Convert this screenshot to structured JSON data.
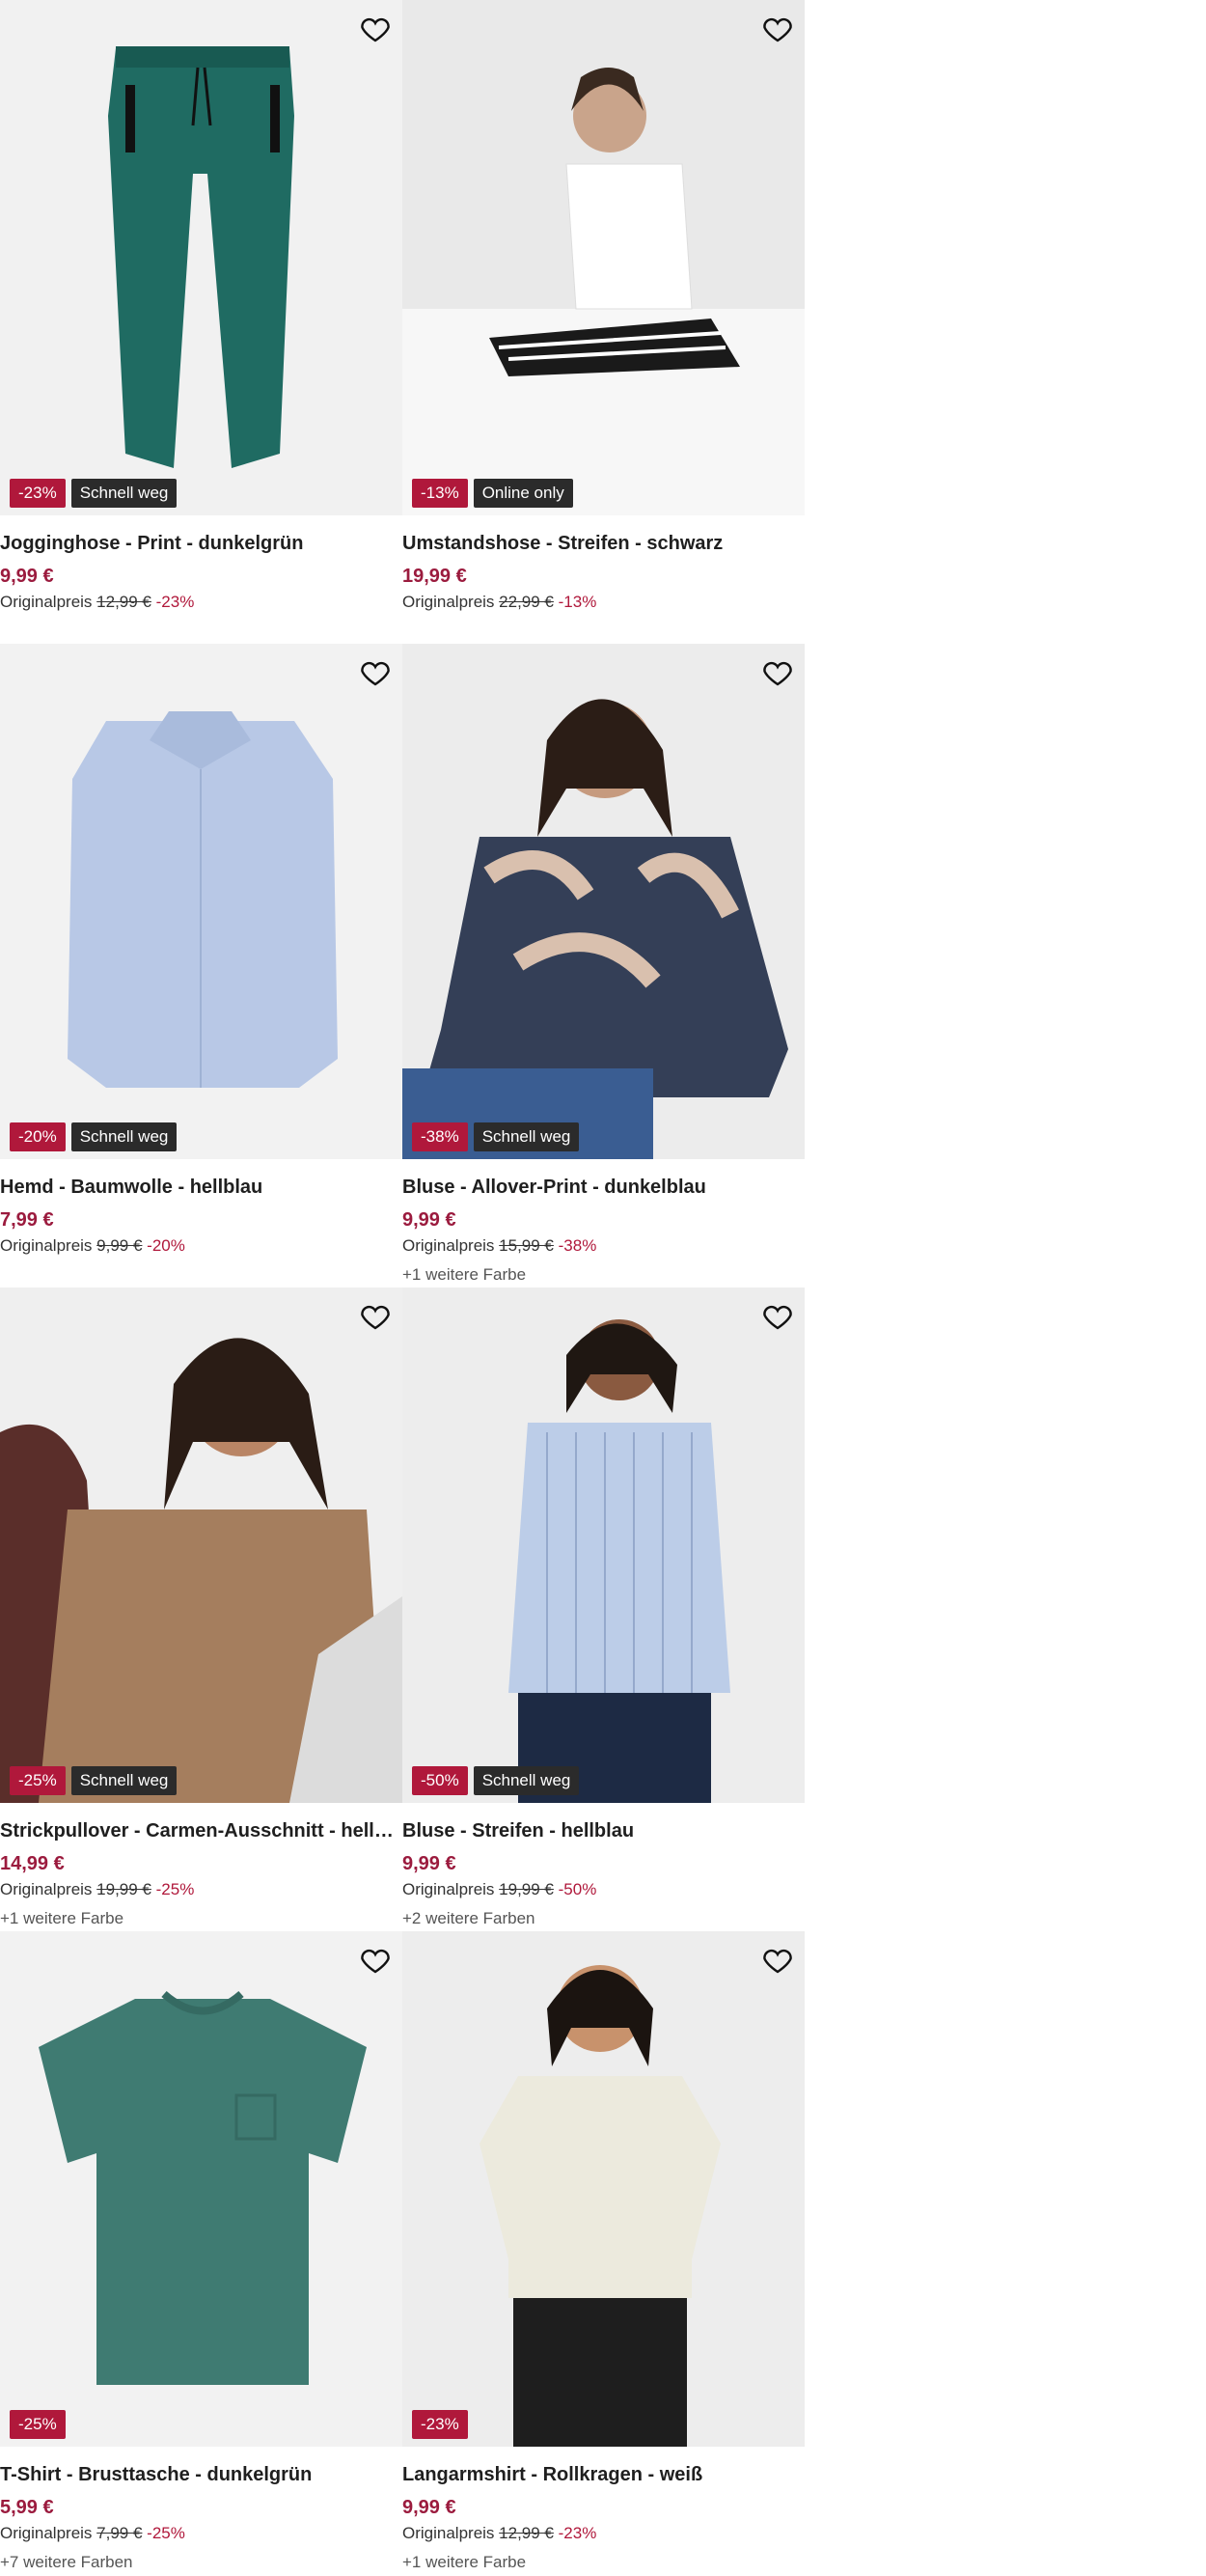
{
  "products": [
    {
      "name": "Jogginghose - Print - dunkelgrün",
      "price": "9,99 €",
      "orig_label": "Originalpreis",
      "orig_price": "12,99 €",
      "discount": "-23%",
      "badge_sale": "-23%",
      "badge_tag": "Schnell weg",
      "colors": ""
    },
    {
      "name": "Umstandshose - Streifen - schwarz",
      "price": "19,99 €",
      "orig_label": "Originalpreis",
      "orig_price": "22,99 €",
      "discount": "-13%",
      "badge_sale": "-13%",
      "badge_tag": "Online only",
      "colors": ""
    },
    {
      "name": "Hemd - Baumwolle - hellblau",
      "price": "7,99 €",
      "orig_label": "Originalpreis",
      "orig_price": "9,99 €",
      "discount": "-20%",
      "badge_sale": "-20%",
      "badge_tag": "Schnell weg",
      "colors": ""
    },
    {
      "name": "Bluse - Allover-Print - dunkelblau",
      "price": "9,99 €",
      "orig_label": "Originalpreis",
      "orig_price": "15,99 €",
      "discount": "-38%",
      "badge_sale": "-38%",
      "badge_tag": "Schnell weg",
      "colors": "+1 weitere Farbe"
    },
    {
      "name": "Strickpullover - Carmen-Ausschnitt - hellbr...",
      "price": "14,99 €",
      "orig_label": "Originalpreis",
      "orig_price": "19,99 €",
      "discount": "-25%",
      "badge_sale": "-25%",
      "badge_tag": "Schnell weg",
      "colors": "+1 weitere Farbe"
    },
    {
      "name": "Bluse - Streifen - hellblau",
      "price": "9,99 €",
      "orig_label": "Originalpreis",
      "orig_price": "19,99 €",
      "discount": "-50%",
      "badge_sale": "-50%",
      "badge_tag": "Schnell weg",
      "colors": "+2 weitere Farben"
    },
    {
      "name": "T-Shirt - Brusttasche - dunkelgrün",
      "price": "5,99 €",
      "orig_label": "Originalpreis",
      "orig_price": "7,99 €",
      "discount": "-25%",
      "badge_sale": "-25%",
      "badge_tag": "",
      "colors": "+7 weitere Farben"
    },
    {
      "name": "Langarmshirt - Rollkragen - weiß",
      "price": "9,99 €",
      "orig_label": "Originalpreis",
      "orig_price": "12,99 €",
      "discount": "-23%",
      "badge_sale": "-23%",
      "badge_tag": "",
      "colors": "+1 weitere Farbe"
    }
  ],
  "colors": {
    "sale": "#b0183b",
    "price": "#9b1b3e",
    "tag": "#2b2b2b",
    "image_bg": "#f2f2f2"
  },
  "icons": {
    "wishlist": "heart-outline-icon"
  }
}
